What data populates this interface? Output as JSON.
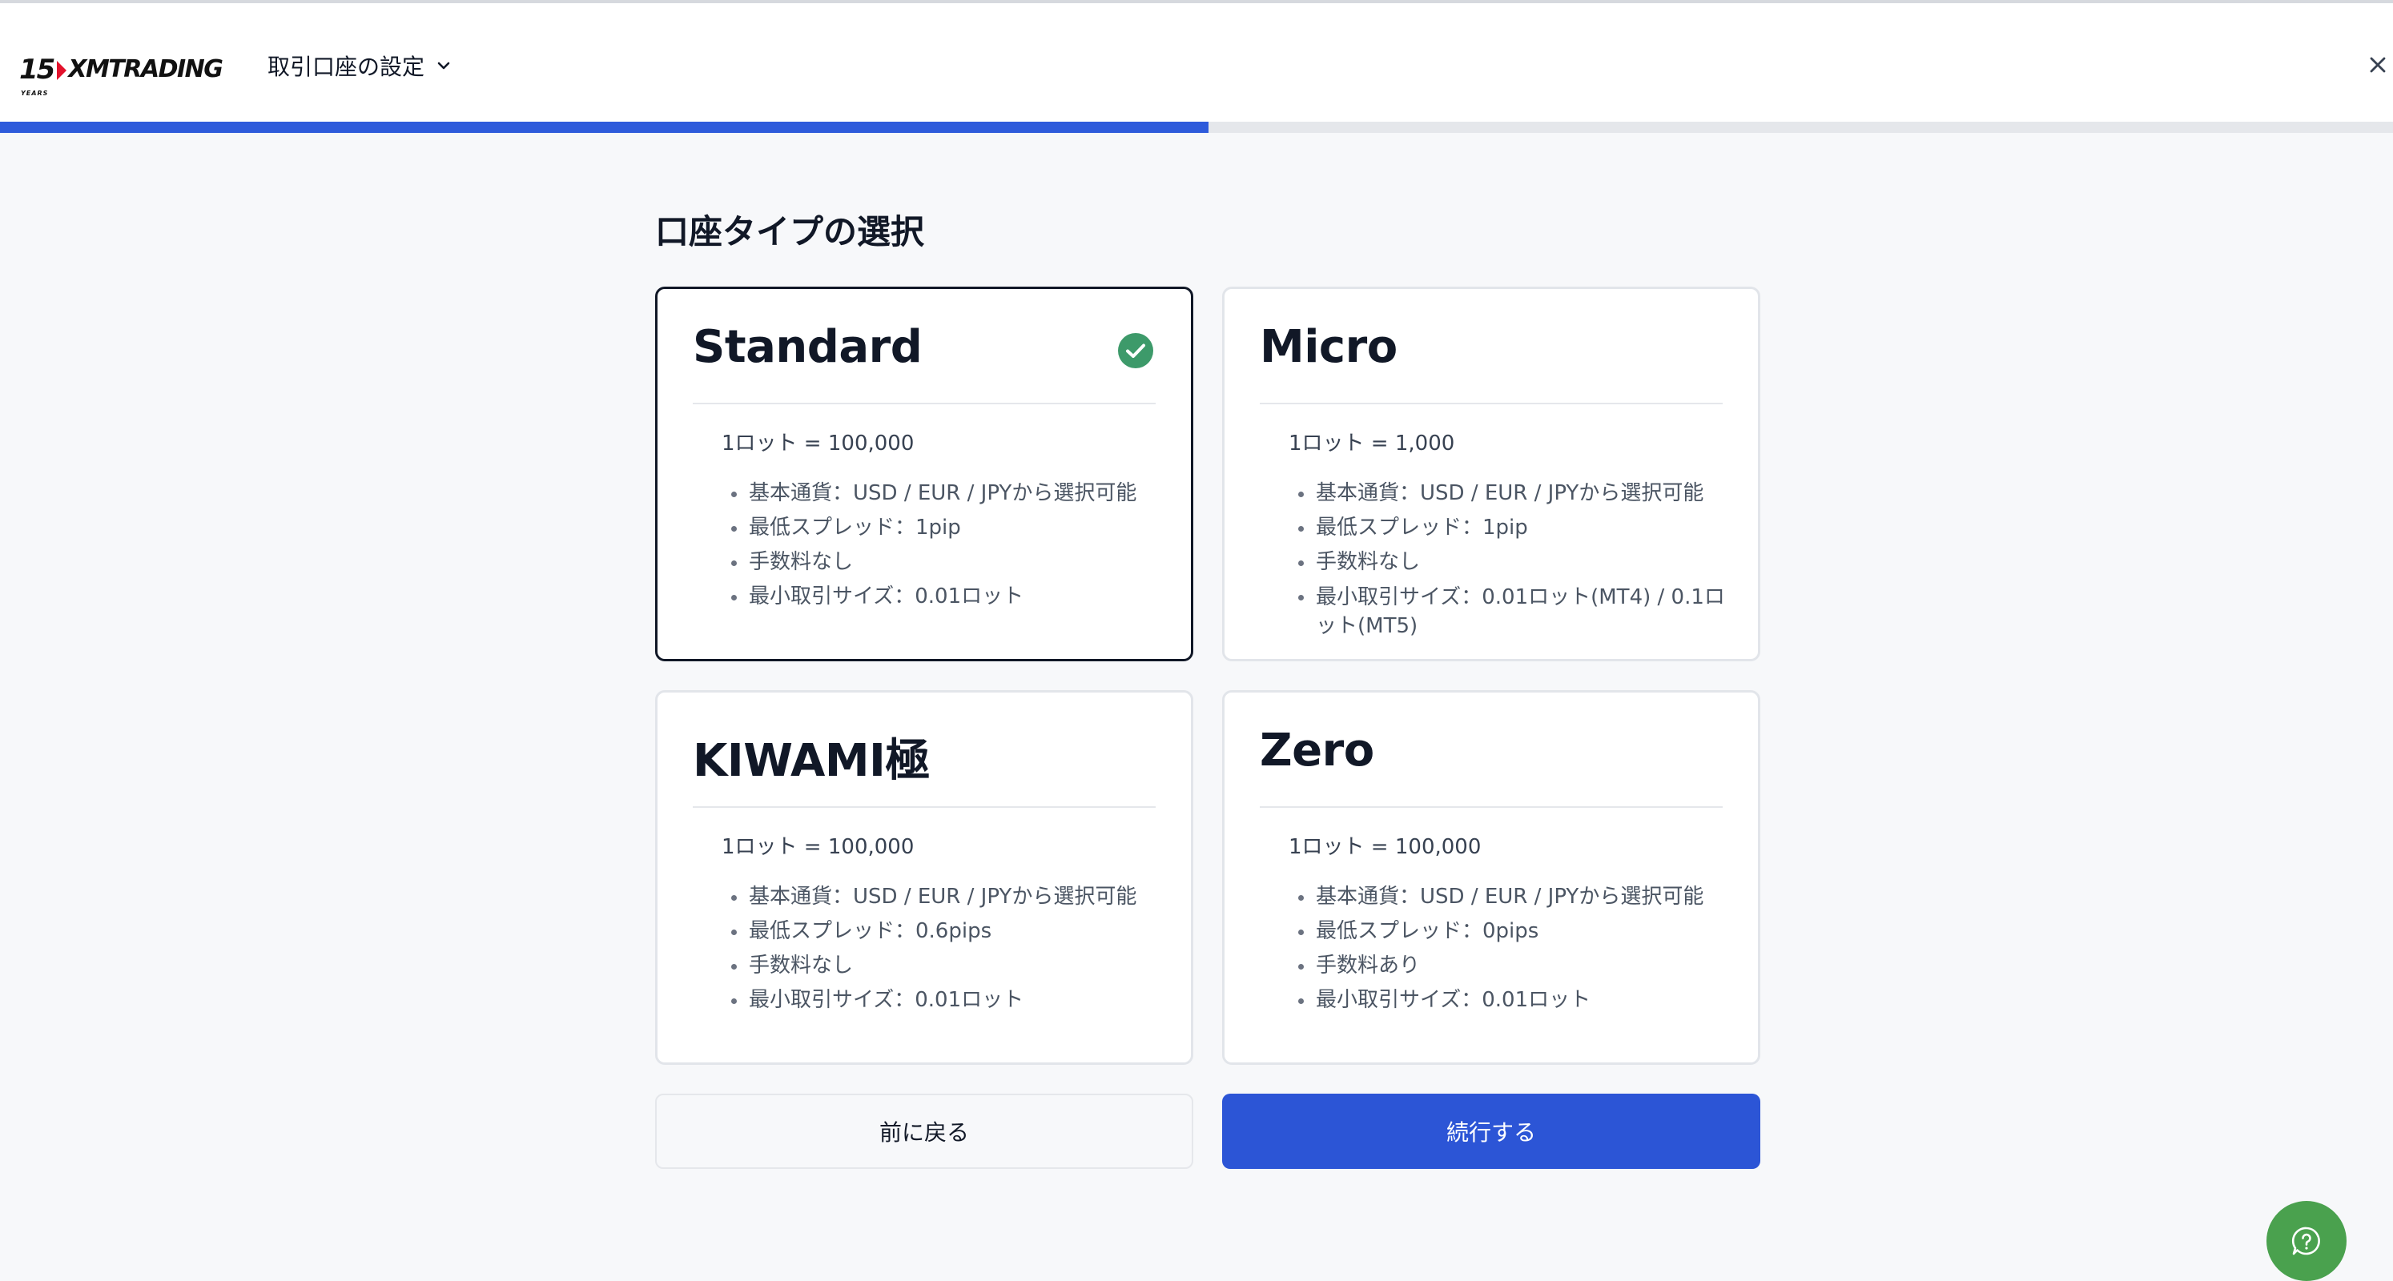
{
  "header": {
    "logo_number": "15",
    "logo_years": "YEARS",
    "logo_text": "XMTRADING",
    "breadcrumb": "取引口座の設定",
    "progress_fraction": 0.505
  },
  "page": {
    "title": "口座タイプの選択"
  },
  "accounts": [
    {
      "name": "Standard",
      "selected": true,
      "lot": "1ロット = 100,000",
      "features": [
        "基本通貨：USD / EUR / JPYから選択可能",
        "最低スプレッド：1pip",
        "手数料なし",
        "最小取引サイズ：0.01ロット"
      ]
    },
    {
      "name": "Micro",
      "selected": false,
      "lot": "1ロット = 1,000",
      "features": [
        "基本通貨：USD / EUR / JPYから選択可能",
        "最低スプレッド：1pip",
        "手数料なし",
        "最小取引サイズ：0.01ロット(MT4) / 0.1ロット(MT5)"
      ]
    },
    {
      "name": "KIWAMI極",
      "selected": false,
      "lot": "1ロット = 100,000",
      "features": [
        "基本通貨：USD / EUR / JPYから選択可能",
        "最低スプレッド：0.6pips",
        "手数料なし",
        "最小取引サイズ：0.01ロット"
      ]
    },
    {
      "name": "Zero",
      "selected": false,
      "lot": "1ロット = 100,000",
      "features": [
        "基本通貨：USD / EUR / JPYから選択可能",
        "最低スプレッド：0pips",
        "手数料あり",
        "最小取引サイズ：0.01ロット"
      ]
    }
  ],
  "buttons": {
    "back": "前に戻る",
    "continue": "続行する"
  },
  "colors": {
    "accent": "#2c55d6",
    "progress": "#2e5bdb",
    "check": "#3d9a6a",
    "help": "#4aa14e"
  },
  "icons": {
    "close": "close-icon",
    "chevron": "chevron-down-icon",
    "check": "check-circle-icon",
    "help": "help-chat-icon"
  }
}
